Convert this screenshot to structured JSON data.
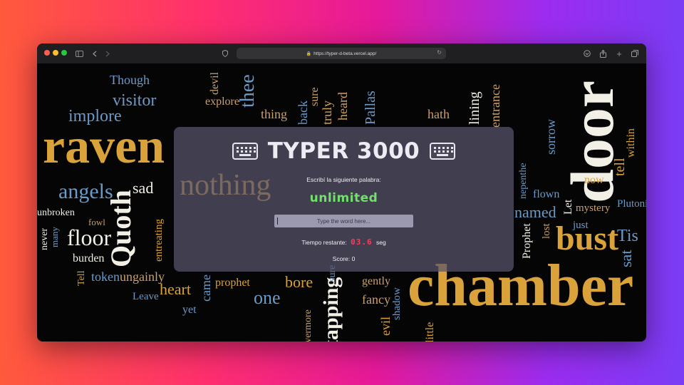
{
  "browser": {
    "url": "https://typer-d-beta.vercel.app/",
    "traffic_light_colors": {
      "close": "#ff5f57",
      "minimize": "#febc2e",
      "zoom": "#28c840"
    }
  },
  "background_words": [
    {
      "text": "raven",
      "color": "#d9a23a"
    },
    {
      "text": "door",
      "color": "#f2efe6"
    },
    {
      "text": "chamber",
      "color": "#d9a23a"
    },
    {
      "text": "bust",
      "color": "#d9a23a"
    },
    {
      "text": "Quoth",
      "color": "#f2efe6"
    },
    {
      "text": "angels",
      "color": "#6a9bc8"
    },
    {
      "text": "floor",
      "color": "#f2efe6"
    },
    {
      "text": "implore",
      "color": "#6a9bc8"
    },
    {
      "text": "visitor",
      "color": "#6a9bc8"
    },
    {
      "text": "Though",
      "color": "#6a9bc8"
    },
    {
      "text": "thee",
      "color": "#6a9bc8"
    },
    {
      "text": "devil",
      "color": "#c9a06a"
    },
    {
      "text": "explore",
      "color": "#c9a06a"
    },
    {
      "text": "thing",
      "color": "#c9a06a"
    },
    {
      "text": "back",
      "color": "#6a9bc8"
    },
    {
      "text": "sure",
      "color": "#c9a06a"
    },
    {
      "text": "truly",
      "color": "#c9a06a"
    },
    {
      "text": "heard",
      "color": "#c9a06a"
    },
    {
      "text": "Pallas",
      "color": "#6a9bc8"
    },
    {
      "text": "hath",
      "color": "#c9a06a"
    },
    {
      "text": "lining",
      "color": "#f2efe6"
    },
    {
      "text": "entrance",
      "color": "#c9a06a"
    },
    {
      "text": "sorrow",
      "color": "#6a9bc8"
    },
    {
      "text": "within",
      "color": "#d9a23a"
    },
    {
      "text": "tell",
      "color": "#d9a23a"
    },
    {
      "text": "now",
      "color": "#d9a23a"
    },
    {
      "text": "nepenthe",
      "color": "#6a9bc8"
    },
    {
      "text": "flown",
      "color": "#6a9bc8"
    },
    {
      "text": "named",
      "color": "#6a9bc8"
    },
    {
      "text": "mystery",
      "color": "#c9a06a"
    },
    {
      "text": "Plutonian",
      "color": "#6a9bc8"
    },
    {
      "text": "Let",
      "color": "#f2efe6"
    },
    {
      "text": "Prophet",
      "color": "#f2efe6"
    },
    {
      "text": "lost",
      "color": "#c9a06a"
    },
    {
      "text": "just",
      "color": "#6a9bc8"
    },
    {
      "text": "Tis",
      "color": "#6a9bc8"
    },
    {
      "text": "sat",
      "color": "#6a9bc8"
    },
    {
      "text": "sad",
      "color": "#f2efe6"
    },
    {
      "text": "burden",
      "color": "#f2efe6"
    },
    {
      "text": "token",
      "color": "#6a9bc8"
    },
    {
      "text": "ungainly",
      "color": "#c9a06a"
    },
    {
      "text": "Tell",
      "color": "#d9a23a"
    },
    {
      "text": "never",
      "color": "#f2efe6"
    },
    {
      "text": "many",
      "color": "#6a9bc8"
    },
    {
      "text": "unbroken",
      "color": "#f2efe6"
    },
    {
      "text": "fowl",
      "color": "#c9a06a"
    },
    {
      "text": "Leave",
      "color": "#6a9bc8"
    },
    {
      "text": "heart",
      "color": "#d9a23a"
    },
    {
      "text": "came",
      "color": "#6a9bc8"
    },
    {
      "text": "yet",
      "color": "#6a9bc8"
    },
    {
      "text": "prophet",
      "color": "#d9a23a"
    },
    {
      "text": "one",
      "color": "#6a9bc8"
    },
    {
      "text": "bore",
      "color": "#d9a23a"
    },
    {
      "text": "tapping",
      "color": "#f2efe6"
    },
    {
      "text": "evermore",
      "color": "#c9a06a"
    },
    {
      "text": "evil",
      "color": "#d9a23a"
    },
    {
      "text": "shadow",
      "color": "#6a9bc8"
    },
    {
      "text": "gently",
      "color": "#c9a06a"
    },
    {
      "text": "fancy",
      "color": "#c9a06a"
    },
    {
      "text": "little",
      "color": "#d9a23a"
    },
    {
      "text": "entreating",
      "color": "#d9a23a"
    },
    {
      "text": "nothing",
      "color": "#d9a23a"
    },
    {
      "text": "sure",
      "color": "#6a9bc8"
    }
  ],
  "card": {
    "title": "TYPER 3000",
    "prompt": "Escribí la siguiente palabra:",
    "target_word": "unlimited",
    "input_placeholder": "Type the word here...",
    "input_value": "",
    "timer_label": "Tiempo restante:",
    "timer_value": "03.6",
    "timer_unit": "seg",
    "score_text": "Score: 0",
    "target_color": "#74e06c",
    "timer_color": "#ff3b5c"
  }
}
